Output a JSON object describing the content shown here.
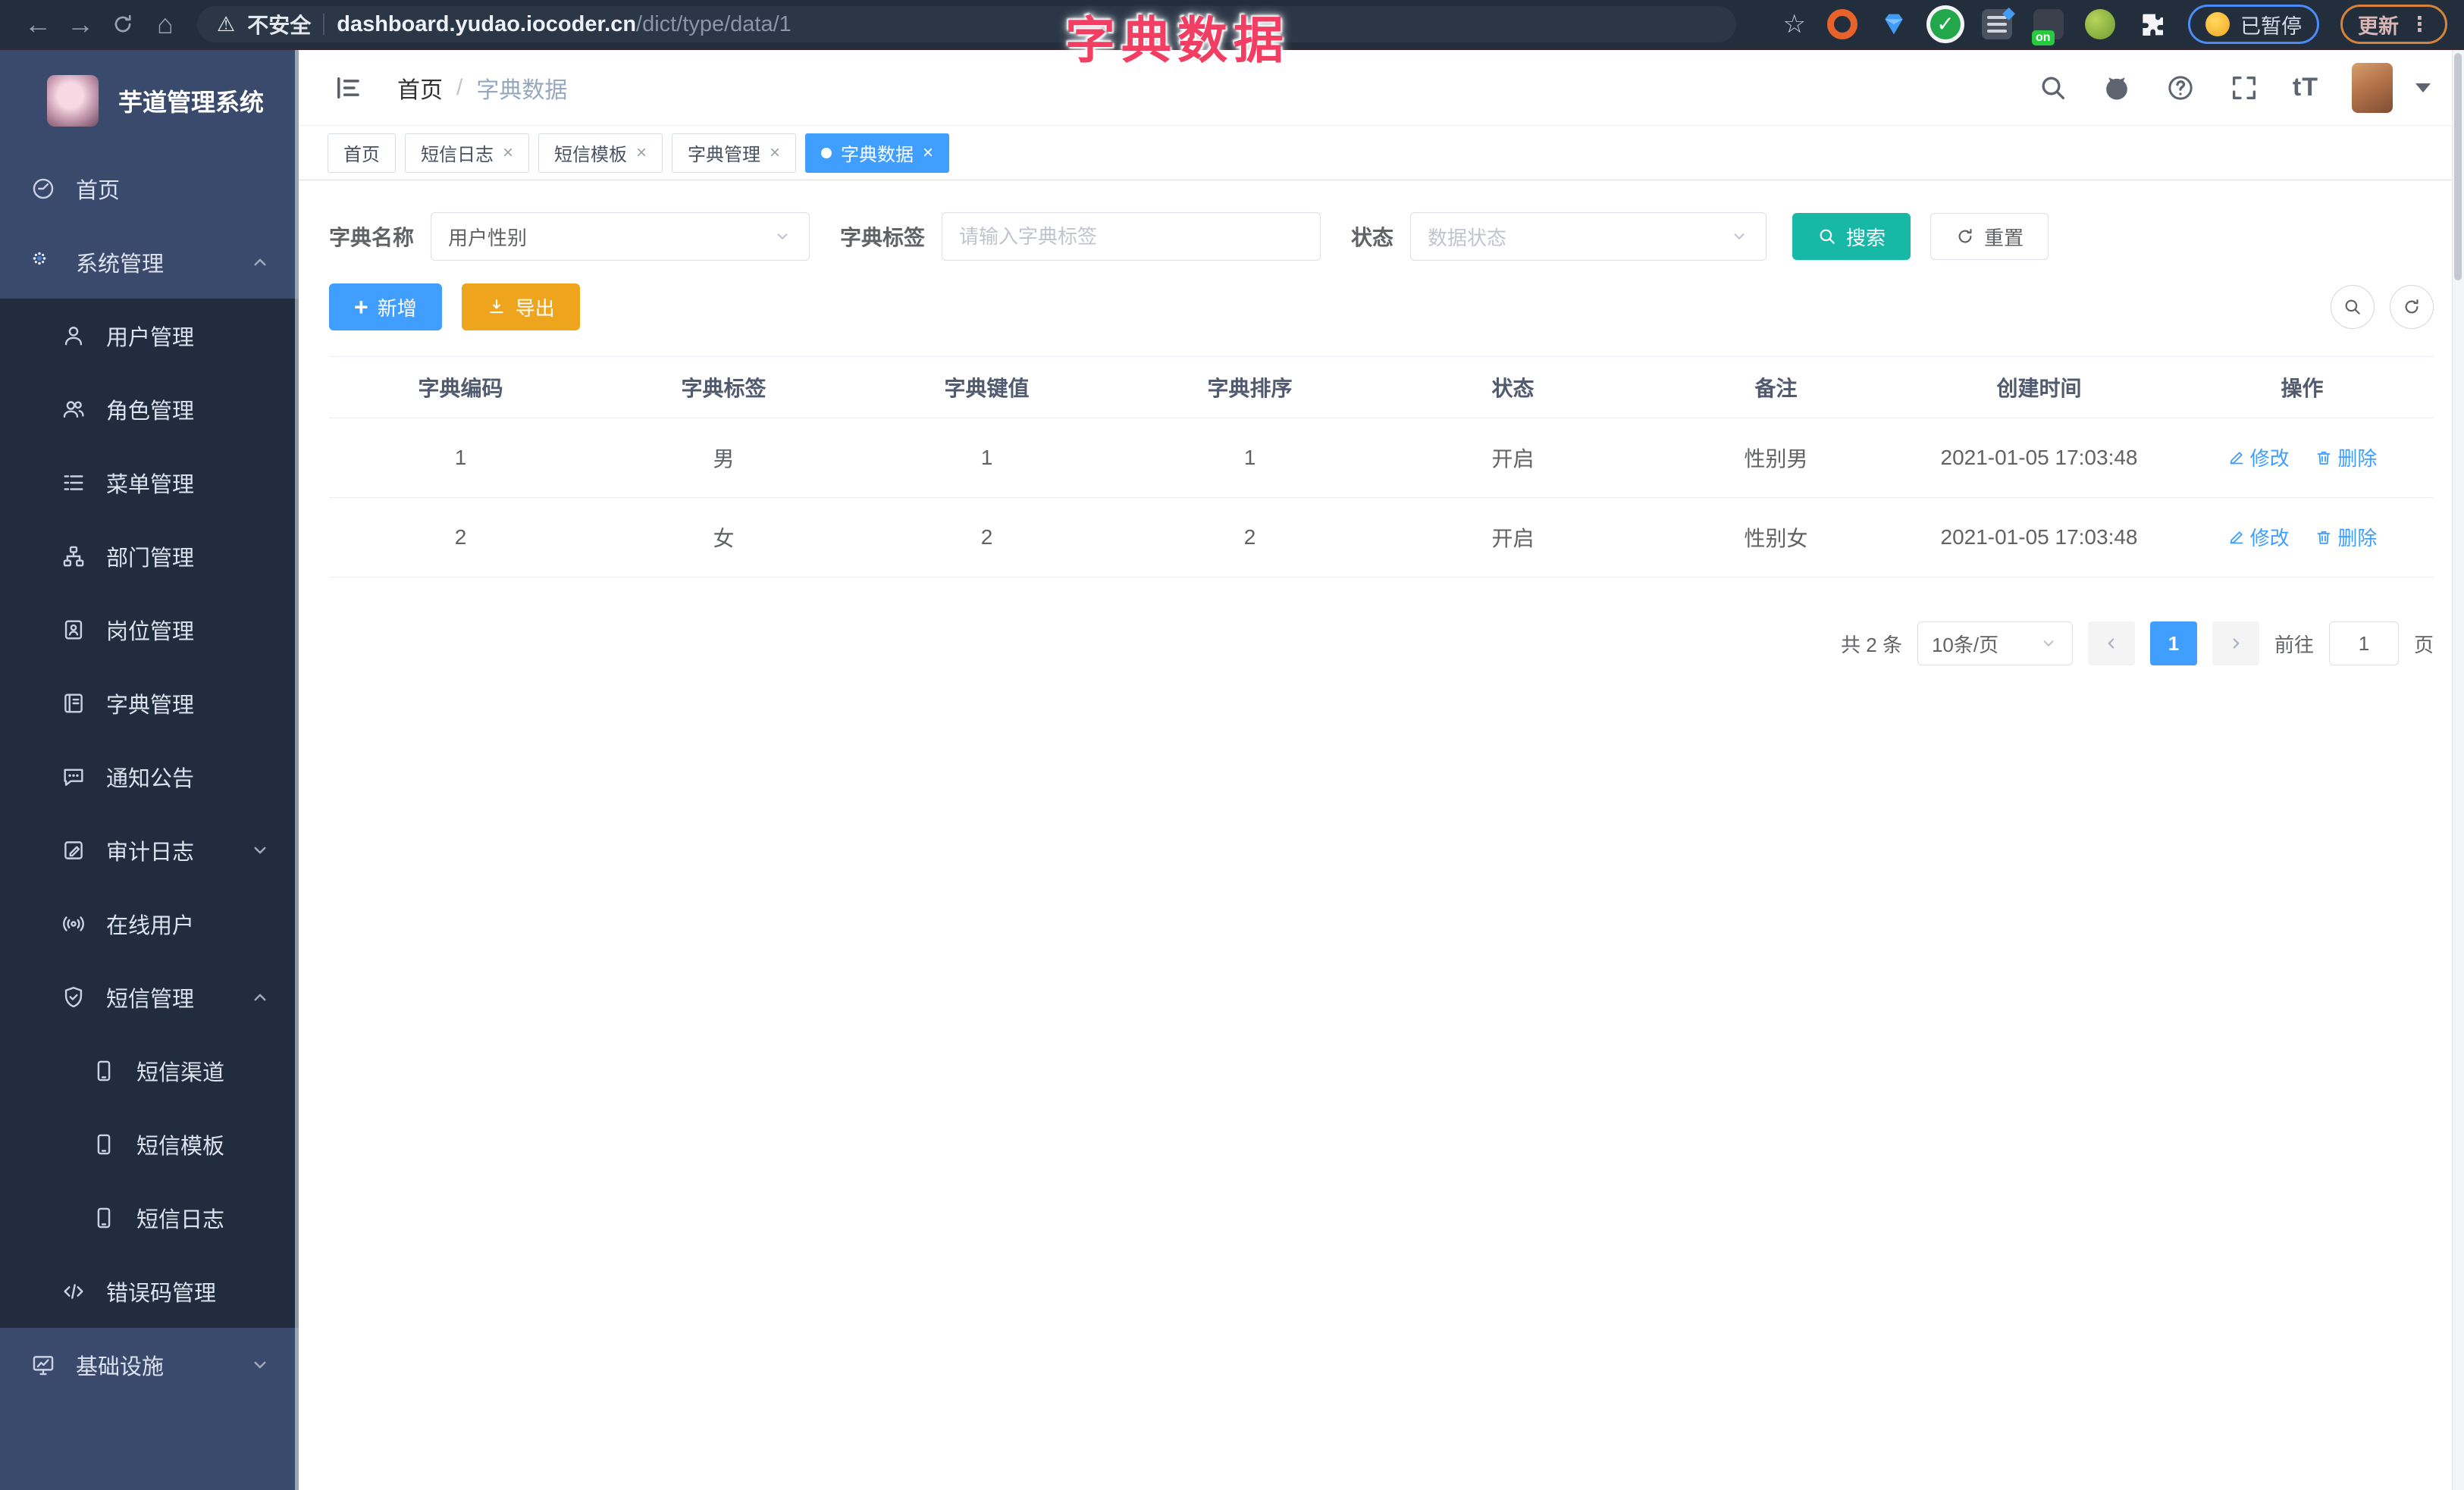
{
  "browser": {
    "security_warning": "不安全",
    "url_host": "dashboard.yudao.iocoder.cn",
    "url_path": "/dict/type/data/1",
    "on_badge": "on",
    "paused_label": "已暂停",
    "update_label": "更新"
  },
  "overlay_title": "字典数据",
  "colors": {
    "accent_blue": "#409eff",
    "teal": "#17b8a6",
    "orange": "#efa41d",
    "title_pink": "#f23e62",
    "sidebar_navy": "#3a4a6d",
    "submenu_dark": "#212c3e"
  },
  "sidebar": {
    "logo_title": "芋道管理系统",
    "items": [
      {
        "label": "首页"
      },
      {
        "label": "系统管理"
      },
      {
        "label": "用户管理"
      },
      {
        "label": "角色管理"
      },
      {
        "label": "菜单管理"
      },
      {
        "label": "部门管理"
      },
      {
        "label": "岗位管理"
      },
      {
        "label": "字典管理"
      },
      {
        "label": "通知公告"
      },
      {
        "label": "审计日志"
      },
      {
        "label": "在线用户"
      },
      {
        "label": "短信管理"
      },
      {
        "label": "短信渠道"
      },
      {
        "label": "短信模板"
      },
      {
        "label": "短信日志"
      },
      {
        "label": "错误码管理"
      },
      {
        "label": "基础设施"
      }
    ]
  },
  "navbar": {
    "breadcrumb_home": "首页",
    "breadcrumb_current": "字典数据"
  },
  "tabs": {
    "items": [
      {
        "label": "首页"
      },
      {
        "label": "短信日志"
      },
      {
        "label": "短信模板"
      },
      {
        "label": "字典管理"
      },
      {
        "label": "字典数据"
      }
    ]
  },
  "filters": {
    "name_label": "字典名称",
    "name_value": "用户性别",
    "tag_label": "字典标签",
    "tag_placeholder": "请输入字典标签",
    "status_label": "状态",
    "status_placeholder": "数据状态",
    "search_label": "搜索",
    "reset_label": "重置"
  },
  "toolbar": {
    "add_label": "新增",
    "export_label": "导出"
  },
  "table": {
    "columns": [
      "字典编码",
      "字典标签",
      "字典键值",
      "字典排序",
      "状态",
      "备注",
      "创建时间",
      "操作"
    ],
    "rows": [
      {
        "code": "1",
        "tag": "男",
        "value": "1",
        "sort": "1",
        "status": "开启",
        "remark": "性别男",
        "created": "2021-01-05 17:03:48",
        "edit": "修改",
        "delete": "删除"
      },
      {
        "code": "2",
        "tag": "女",
        "value": "2",
        "sort": "2",
        "status": "开启",
        "remark": "性别女",
        "created": "2021-01-05 17:03:48",
        "edit": "修改",
        "delete": "删除"
      }
    ]
  },
  "pagination": {
    "total_text": "共 2 条",
    "page_size": "10条/页",
    "current_page": "1",
    "goto_label": "前往",
    "goto_value": "1",
    "page_unit": "页"
  }
}
